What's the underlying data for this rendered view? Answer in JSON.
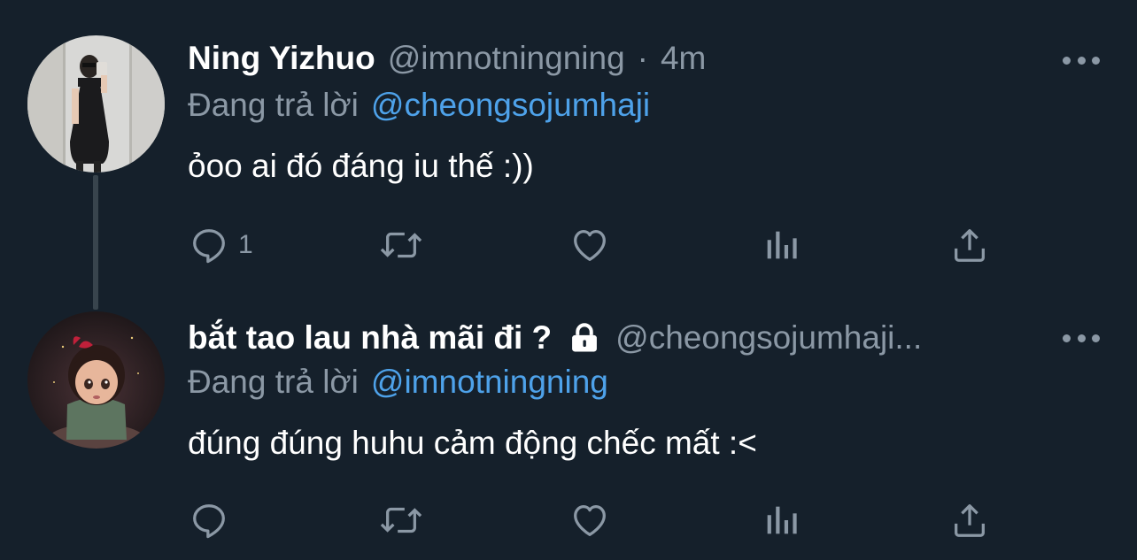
{
  "tweets": [
    {
      "display_name": "Ning Yizhuo",
      "handle": "@imnotningning",
      "separator": "·",
      "timestamp": "4m",
      "reply_prefix": "Đang trả lời",
      "reply_to": "@cheongsojumhaji",
      "text": "ỏoo ai đó đáng iu thế :))",
      "reply_count": "1",
      "locked": false
    },
    {
      "display_name": "bắt tao lau nhà mãi đi ?",
      "handle": "@cheongsojumhaji...",
      "reply_prefix": "Đang trả lời",
      "reply_to": "@imnotningning",
      "text": "đúng đúng huhu cảm động chếc mất :<",
      "reply_count": "",
      "locked": true
    }
  ],
  "icons": {
    "reply": "reply-icon",
    "retweet": "retweet-icon",
    "like": "heart-icon",
    "analytics": "analytics-icon",
    "share": "share-icon",
    "more": "more-icon",
    "lock": "lock-icon"
  },
  "colors": {
    "background": "#15202b",
    "text_primary": "#ffffff",
    "text_secondary": "#8b98a5",
    "link": "#4ea2ea",
    "thread_line": "#38444d"
  }
}
